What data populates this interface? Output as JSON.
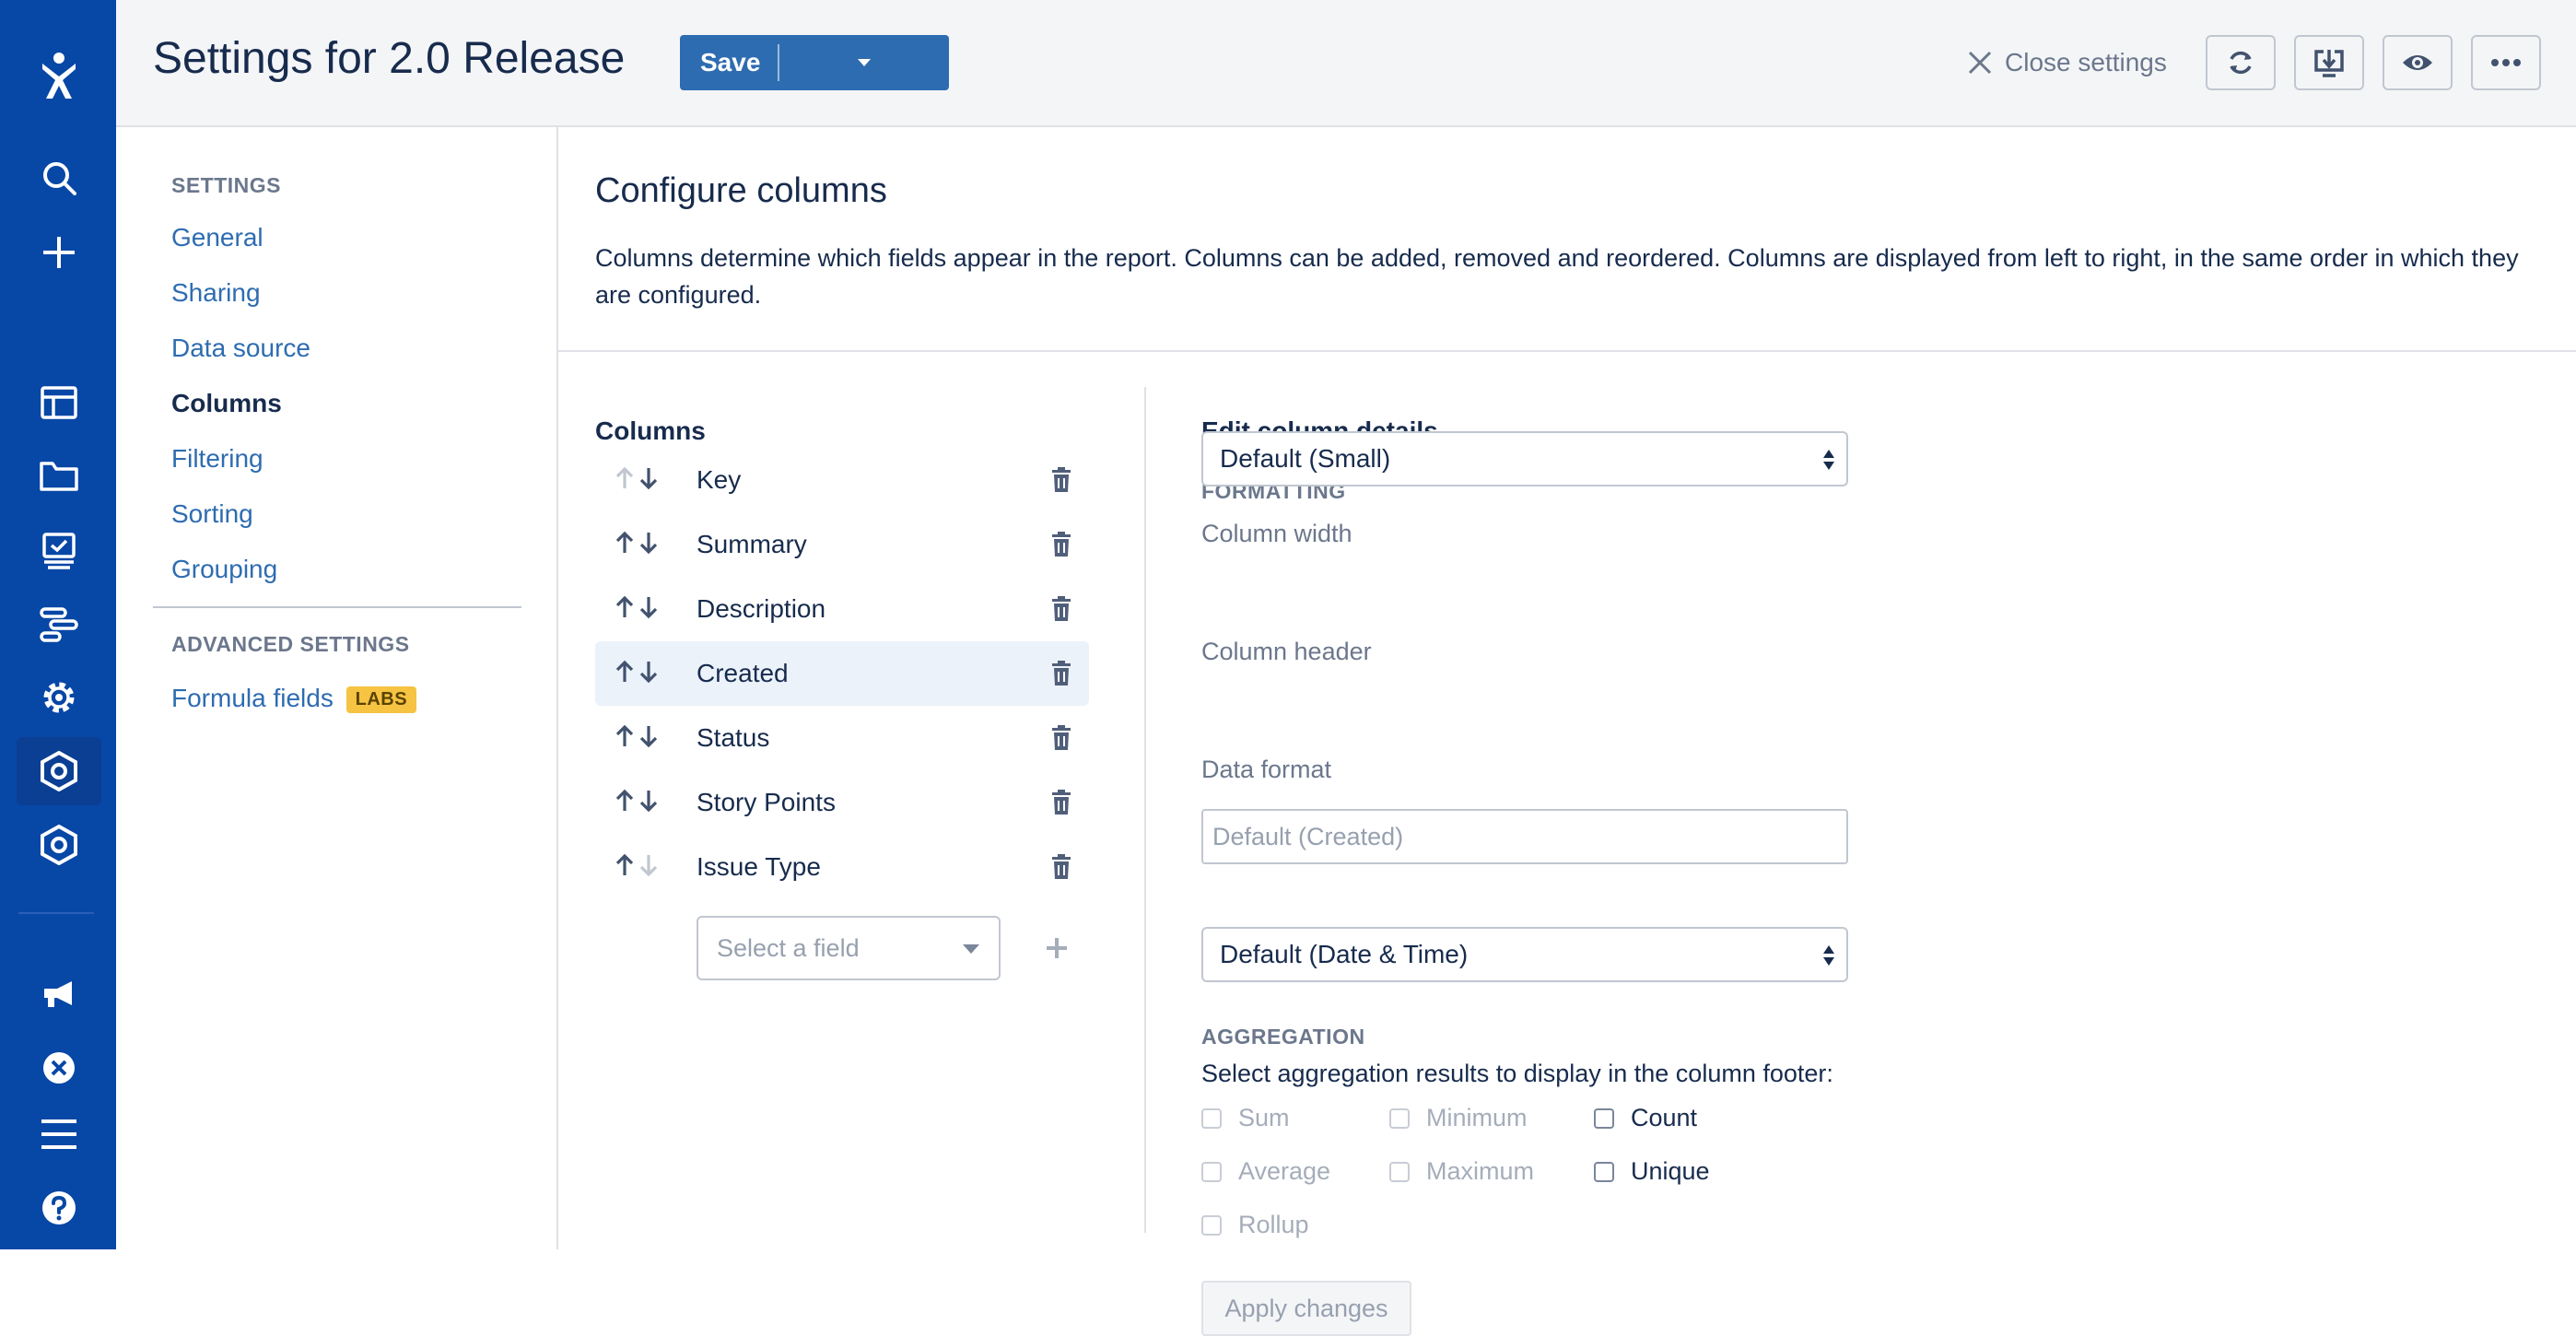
{
  "header": {
    "title": "Settings for 2.0 Release",
    "save_label": "Save",
    "close_label": "Close settings"
  },
  "sidebar": {
    "settings_heading": "SETTINGS",
    "items": [
      {
        "label": "General"
      },
      {
        "label": "Sharing"
      },
      {
        "label": "Data source"
      },
      {
        "label": "Columns",
        "current": true
      },
      {
        "label": "Filtering"
      },
      {
        "label": "Sorting"
      },
      {
        "label": "Grouping"
      }
    ],
    "advanced_heading": "ADVANCED SETTINGS",
    "formula_label": "Formula fields",
    "labs_badge": "LABS"
  },
  "main": {
    "title": "Configure columns",
    "description": "Columns determine which fields appear in the report. Columns can be added, removed and reordered. Columns are displayed from left to right, in the same order in which they are configured."
  },
  "columns": {
    "heading": "Columns",
    "items": [
      "Key",
      "Summary",
      "Description",
      "Created",
      "Status",
      "Story Points",
      "Issue Type"
    ],
    "selected": "Created",
    "select_placeholder": "Select a field"
  },
  "edit": {
    "heading": "Edit column details",
    "formatting_label": "FORMATTING",
    "width_label": "Column width",
    "width_value": "Default (Small)",
    "header_label": "Column header",
    "header_placeholder": "Default (Created)",
    "format_label": "Data format",
    "format_value": "Default (Date & Time)",
    "aggregation_label": "AGGREGATION",
    "aggregation_desc": "Select aggregation results to display in the column footer:",
    "options": {
      "sum": "Sum",
      "minimum": "Minimum",
      "count": "Count",
      "average": "Average",
      "maximum": "Maximum",
      "unique": "Unique",
      "rollup": "Rollup"
    },
    "apply_label": "Apply changes"
  },
  "colors": {
    "nav_bg": "#0747a6",
    "primary": "#2e6cb1",
    "labs": "#f6c342"
  }
}
